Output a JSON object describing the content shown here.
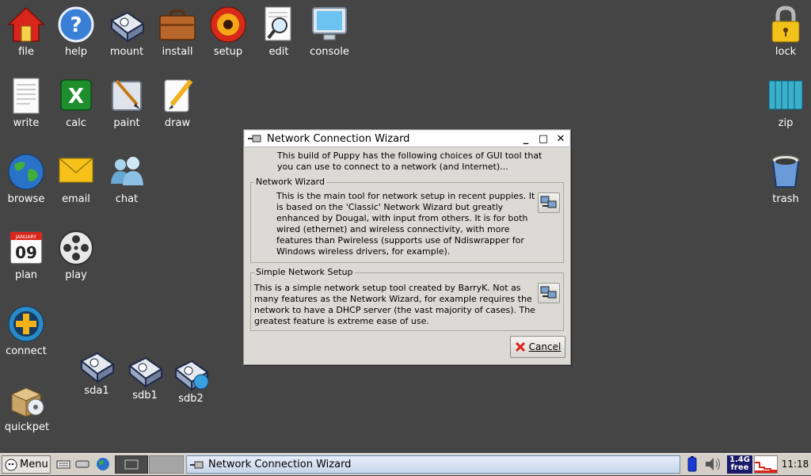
{
  "desktop": {
    "icons": {
      "file": "file",
      "help": "help",
      "mount": "mount",
      "install": "install",
      "setup": "setup",
      "edit": "edit",
      "console": "console",
      "write": "write",
      "calc": "calc",
      "paint": "paint",
      "draw": "draw",
      "browse": "browse",
      "email": "email",
      "chat": "chat",
      "plan": "plan",
      "play": "play",
      "connect": "connect",
      "quickpet": "quickpet",
      "sda1": "sda1",
      "sdb1": "sdb1",
      "sdb2": "sdb2",
      "lock": "lock",
      "zip": "zip",
      "trash": "trash"
    },
    "calendar_month": "JANUARY",
    "calendar_day": "09"
  },
  "dialog": {
    "title": "Network Connection Wizard",
    "intro": "This build of Puppy has the following choices of GUI tool that you can use to connect to a network (and Internet)...",
    "network_wizard": {
      "legend": "Network Wizard",
      "text": "This is the main tool for network setup in recent puppies. It is based on the 'Classic' Network Wizard but greatly enhanced by Dougal, with input from others. It is for both wired (ethernet) and wireless connectivity, with more features than Pwireless (supports use of Ndiswrapper for Windows wireless drivers, for example)."
    },
    "simple_setup": {
      "legend": "Simple Network Setup",
      "text": "This is a simple network setup tool created by BarryK. Not as many features as the Network Wizard, for example requires the network to have a DHCP server (the vast majority of cases). The greatest feature is extreme ease of use."
    },
    "cancel_label": "Cancel"
  },
  "taskbar": {
    "menu_label": "Menu",
    "task_label": "Network Connection Wizard",
    "mem_top": "1.4G",
    "mem_bottom": "free",
    "clock": "11:18"
  },
  "colors": {
    "desktop_bg": "#454545",
    "dialog_bg": "#dcdad5",
    "taskbar_bg": "#d4d0c8"
  }
}
